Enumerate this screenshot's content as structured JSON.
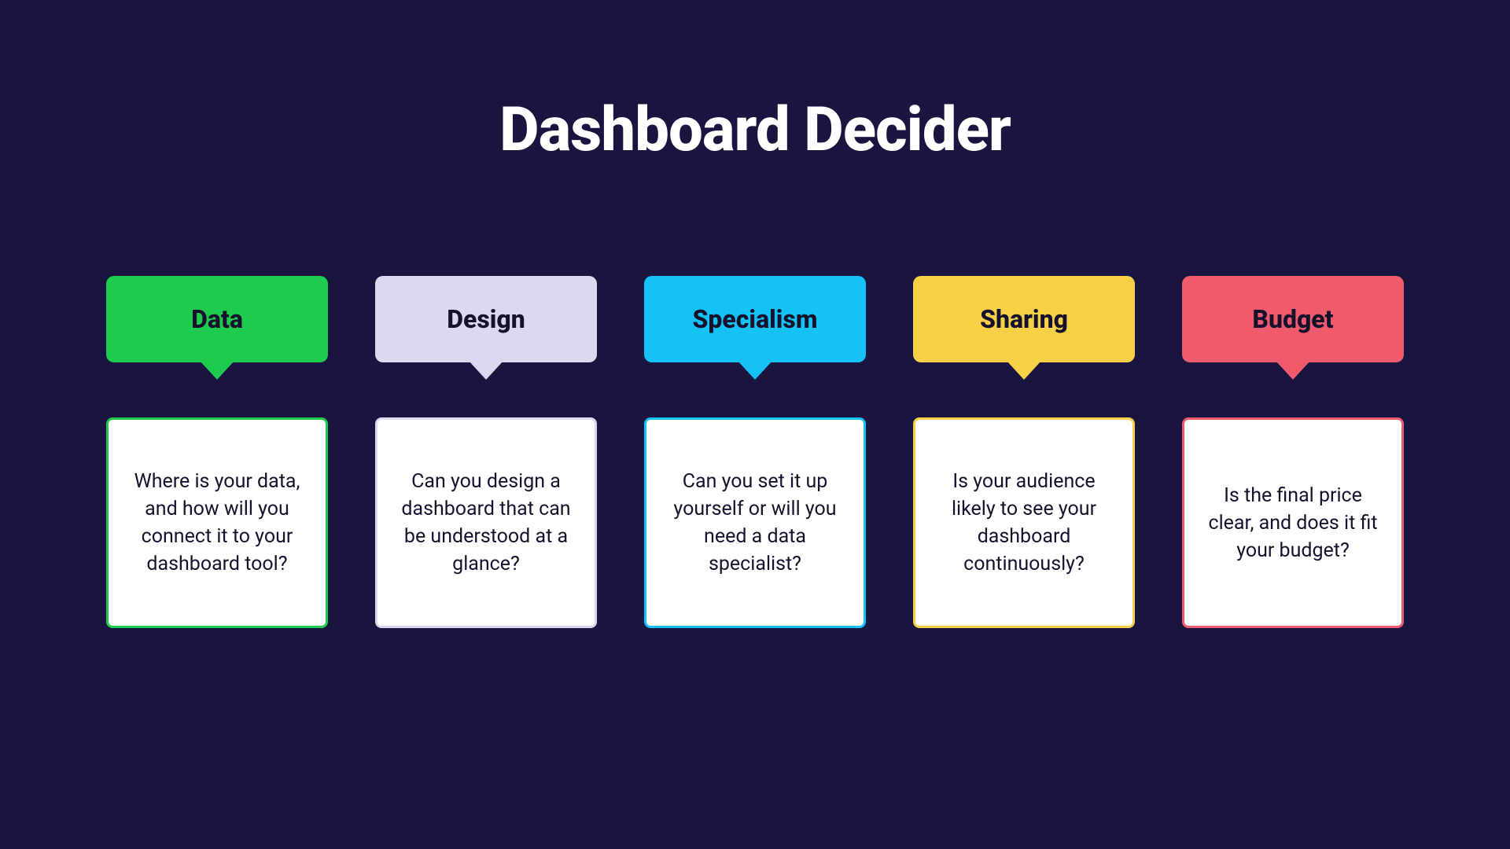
{
  "title": "Dashboard Decider",
  "colors": {
    "background": "#1a1440",
    "data": "#1fcb4f",
    "design": "#ddd8f0",
    "specialism": "#14c3f4",
    "sharing": "#f6d147",
    "budget": "#ef5b6c"
  },
  "columns": [
    {
      "label": "Data",
      "desc": "Where is your data, and how will you connect it to your dashboard tool?"
    },
    {
      "label": "Design",
      "desc": "Can you design a dashboard that can be understood at a glance?"
    },
    {
      "label": "Specialism",
      "desc": "Can you set it up yourself or will you need a data specialist?"
    },
    {
      "label": "Sharing",
      "desc": "Is your audience likely to see your dashboard continuously?"
    },
    {
      "label": "Budget",
      "desc": "Is the final price clear, and does it fit your budget?"
    }
  ]
}
